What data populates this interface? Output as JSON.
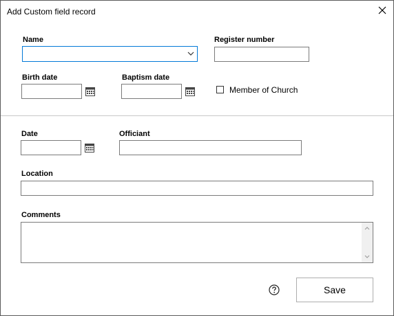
{
  "window": {
    "title": "Add Custom field record"
  },
  "fields": {
    "name": {
      "label": "Name",
      "value": ""
    },
    "register_number": {
      "label": "Register number",
      "value": ""
    },
    "birth_date": {
      "label": "Birth date",
      "value": ""
    },
    "baptism_date": {
      "label": "Baptism date",
      "value": ""
    },
    "member_of_church": {
      "label": "Member of Church",
      "checked": false
    },
    "date": {
      "label": "Date",
      "value": ""
    },
    "officiant": {
      "label": "Officiant",
      "value": ""
    },
    "location": {
      "label": "Location",
      "value": ""
    },
    "comments": {
      "label": "Comments",
      "value": ""
    }
  },
  "buttons": {
    "save": "Save"
  },
  "icons": [
    "close-icon",
    "chevron-down-icon",
    "calendar-icon",
    "help-icon",
    "scroll-up-icon",
    "scroll-down-icon"
  ],
  "colors": {
    "focus_border": "#0078d7",
    "field_border": "#7a7a7a",
    "divider": "#c8c8c8"
  }
}
